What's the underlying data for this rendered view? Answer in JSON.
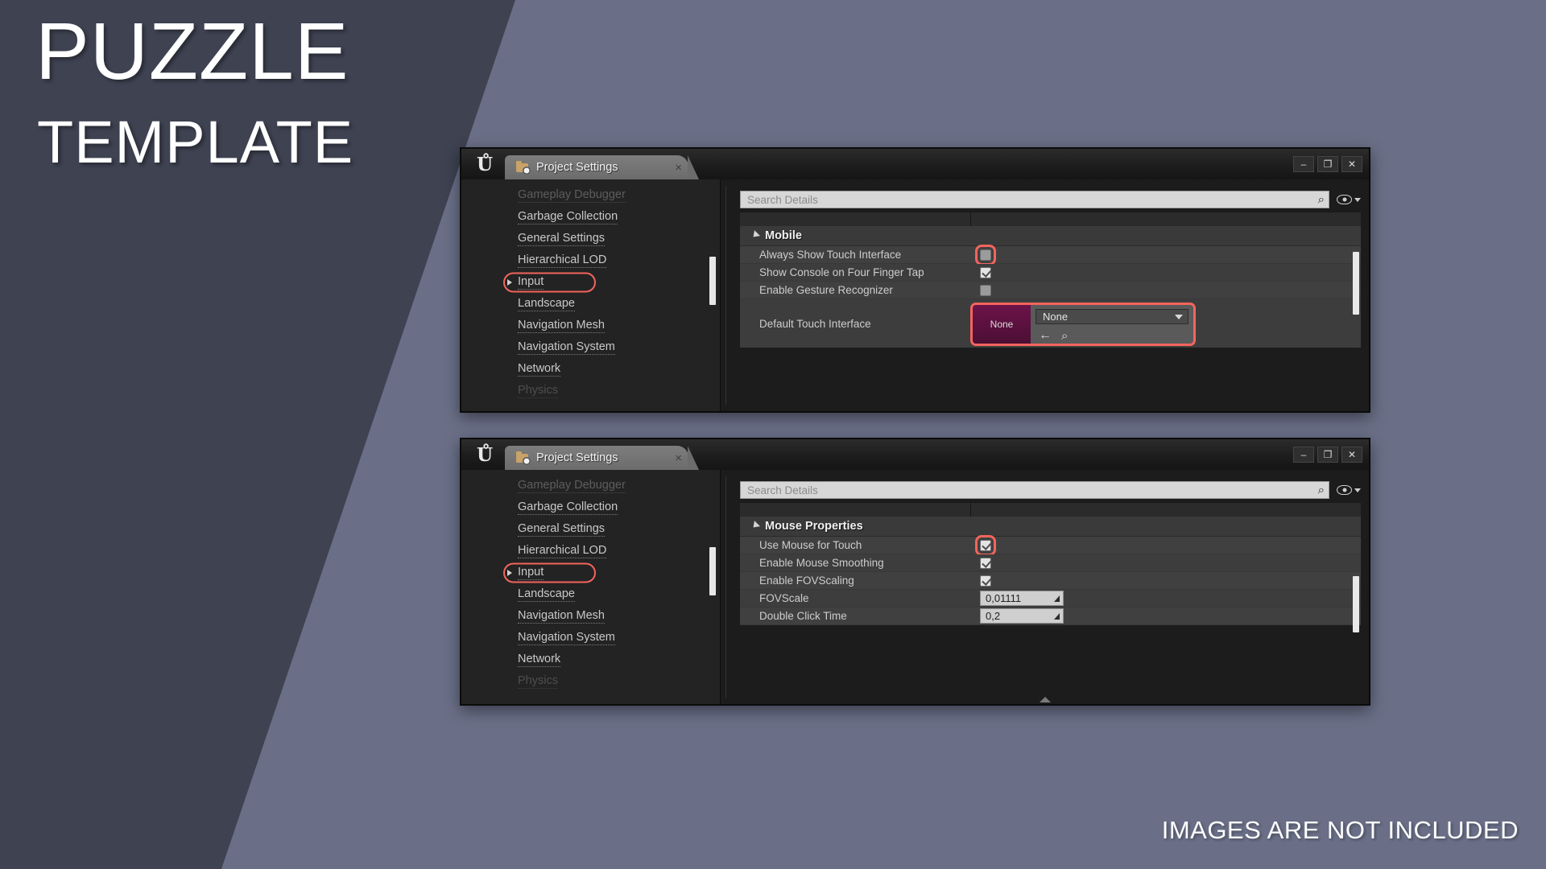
{
  "poster": {
    "title_line1": "PUZZLE",
    "title_line2": "TEMPLATE",
    "footnote": "IMAGES ARE NOT INCLUDED",
    "accent_highlight": "#f4645c",
    "bg_dark": "#3e4251",
    "bg_light": "#6a6f87"
  },
  "windows": [
    {
      "id": "mobile",
      "logo": "Ů",
      "tab_label": "Project Settings",
      "tab_close": "×",
      "buttons": {
        "minimize": "–",
        "maximize": "❐",
        "close": "✕"
      },
      "search": {
        "placeholder": "Search Details",
        "magnifier_icon": "⌕"
      },
      "sidebar": {
        "items": [
          {
            "label": "Gameplay Debugger",
            "state": "clipped-top",
            "expandable": false,
            "highlighted": false
          },
          {
            "label": "Garbage Collection",
            "state": "normal",
            "expandable": false,
            "highlighted": false
          },
          {
            "label": "General Settings",
            "state": "normal",
            "expandable": false,
            "highlighted": false
          },
          {
            "label": "Hierarchical LOD",
            "state": "normal",
            "expandable": false,
            "highlighted": false
          },
          {
            "label": "Input",
            "state": "normal",
            "expandable": true,
            "highlighted": true
          },
          {
            "label": "Landscape",
            "state": "normal",
            "expandable": false,
            "highlighted": false
          },
          {
            "label": "Navigation Mesh",
            "state": "normal",
            "expandable": false,
            "highlighted": false
          },
          {
            "label": "Navigation System",
            "state": "normal",
            "expandable": false,
            "highlighted": false
          },
          {
            "label": "Network",
            "state": "normal",
            "expandable": false,
            "highlighted": false
          },
          {
            "label": "Physics",
            "state": "clipped-bottom",
            "expandable": false,
            "highlighted": false
          }
        ]
      },
      "category": {
        "label": "Mobile"
      },
      "properties": [
        {
          "name": "Always Show Touch Interface",
          "type": "checkbox",
          "checked": false,
          "highlighted": true
        },
        {
          "name": "Show Console on Four Finger Tap",
          "type": "checkbox",
          "checked": true,
          "highlighted": false
        },
        {
          "name": "Enable Gesture Recognizer",
          "type": "checkbox",
          "checked": false,
          "highlighted": false
        },
        {
          "name": "Default Touch Interface",
          "type": "asset",
          "thumb_label": "None",
          "value": "None",
          "highlighted": true
        }
      ]
    },
    {
      "id": "mouse",
      "logo": "Ů",
      "tab_label": "Project Settings",
      "tab_close": "×",
      "buttons": {
        "minimize": "–",
        "maximize": "❐",
        "close": "✕"
      },
      "search": {
        "placeholder": "Search Details",
        "magnifier_icon": "⌕"
      },
      "sidebar": {
        "items": [
          {
            "label": "Gameplay Debugger",
            "state": "clipped-top",
            "expandable": false,
            "highlighted": false
          },
          {
            "label": "Garbage Collection",
            "state": "normal",
            "expandable": false,
            "highlighted": false
          },
          {
            "label": "General Settings",
            "state": "normal",
            "expandable": false,
            "highlighted": false
          },
          {
            "label": "Hierarchical LOD",
            "state": "normal",
            "expandable": false,
            "highlighted": false
          },
          {
            "label": "Input",
            "state": "normal",
            "expandable": true,
            "highlighted": true
          },
          {
            "label": "Landscape",
            "state": "normal",
            "expandable": false,
            "highlighted": false
          },
          {
            "label": "Navigation Mesh",
            "state": "normal",
            "expandable": false,
            "highlighted": false
          },
          {
            "label": "Navigation System",
            "state": "normal",
            "expandable": false,
            "highlighted": false
          },
          {
            "label": "Network",
            "state": "normal",
            "expandable": false,
            "highlighted": false
          },
          {
            "label": "Physics",
            "state": "clipped-bottom",
            "expandable": false,
            "highlighted": false
          }
        ]
      },
      "category": {
        "label": "Mouse Properties"
      },
      "properties": [
        {
          "name": "Use Mouse for Touch",
          "type": "checkbox",
          "checked": true,
          "highlighted": true
        },
        {
          "name": "Enable Mouse Smoothing",
          "type": "checkbox",
          "checked": true,
          "highlighted": false
        },
        {
          "name": "Enable FOVScaling",
          "type": "checkbox",
          "checked": true,
          "highlighted": false
        },
        {
          "name": "FOVScale",
          "type": "number",
          "value": "0,01111",
          "highlighted": false
        },
        {
          "name": "Double Click Time",
          "type": "number",
          "value": "0,2",
          "highlighted": false
        }
      ]
    }
  ]
}
